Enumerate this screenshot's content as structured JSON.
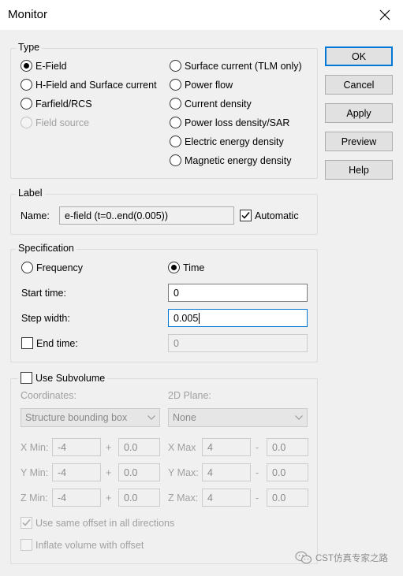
{
  "window": {
    "title": "Monitor"
  },
  "buttons": {
    "ok": "OK",
    "cancel": "Cancel",
    "apply": "Apply",
    "preview": "Preview",
    "help": "Help"
  },
  "type_group": {
    "title": "Type",
    "options": [
      {
        "label": "E-Field",
        "checked": true
      },
      {
        "label": "H-Field and Surface current"
      },
      {
        "label": "Farfield/RCS"
      },
      {
        "label": "Field source",
        "disabled": true
      },
      {
        "label": "Surface current (TLM only)"
      },
      {
        "label": "Power flow"
      },
      {
        "label": "Current density"
      },
      {
        "label": "Power loss density/SAR"
      },
      {
        "label": "Electric energy density"
      },
      {
        "label": "Magnetic energy density"
      }
    ]
  },
  "label_group": {
    "title": "Label",
    "name_label": "Name:",
    "name_value": "e-field (t=0..end(0.005))",
    "automatic_label": "Automatic",
    "automatic_checked": true
  },
  "specification": {
    "title": "Specification",
    "frequency_label": "Frequency",
    "time_label": "Time",
    "selected": "Time",
    "start_time_label": "Start time:",
    "start_time_value": "0",
    "step_width_label": "Step width:",
    "step_width_value": "0.005",
    "end_time_label": "End time:",
    "end_time_value": "0",
    "end_time_checked": false
  },
  "subvolume": {
    "title": "Use Subvolume",
    "checked": false,
    "coordinates_label": "Coordinates:",
    "coordinates_value": "Structure bounding box",
    "plane_label": "2D Plane:",
    "plane_value": "None",
    "rows": [
      {
        "min_label": "X Min:",
        "min": "-4",
        "min_offset": "0.0",
        "max_label": "X Max",
        "max": "4",
        "max_offset": "0.0"
      },
      {
        "min_label": "Y Min:",
        "min": "-4",
        "min_offset": "0.0",
        "max_label": "Y Max:",
        "max": "4",
        "max_offset": "0.0"
      },
      {
        "min_label": "Z Min:",
        "min": "-4",
        "min_offset": "0.0",
        "max_label": "Z Max:",
        "max": "4",
        "max_offset": "0.0"
      }
    ],
    "plus_sign": "+",
    "minus_sign": "-",
    "same_offset_label": "Use same offset in all directions",
    "same_offset_checked": true,
    "inflate_label": "Inflate volume with offset",
    "inflate_checked": false
  },
  "watermark": {
    "text": "CST仿真专家之路"
  },
  "icons": {
    "close": "close-icon",
    "check": "checkmark-icon",
    "dropdown": "chevron-down-icon",
    "wechat": "wechat-logo-icon"
  },
  "colors": {
    "accent": "#0078d7",
    "dialog_bg": "#f0f0f0",
    "disabled_text": "#a0a0a0"
  }
}
